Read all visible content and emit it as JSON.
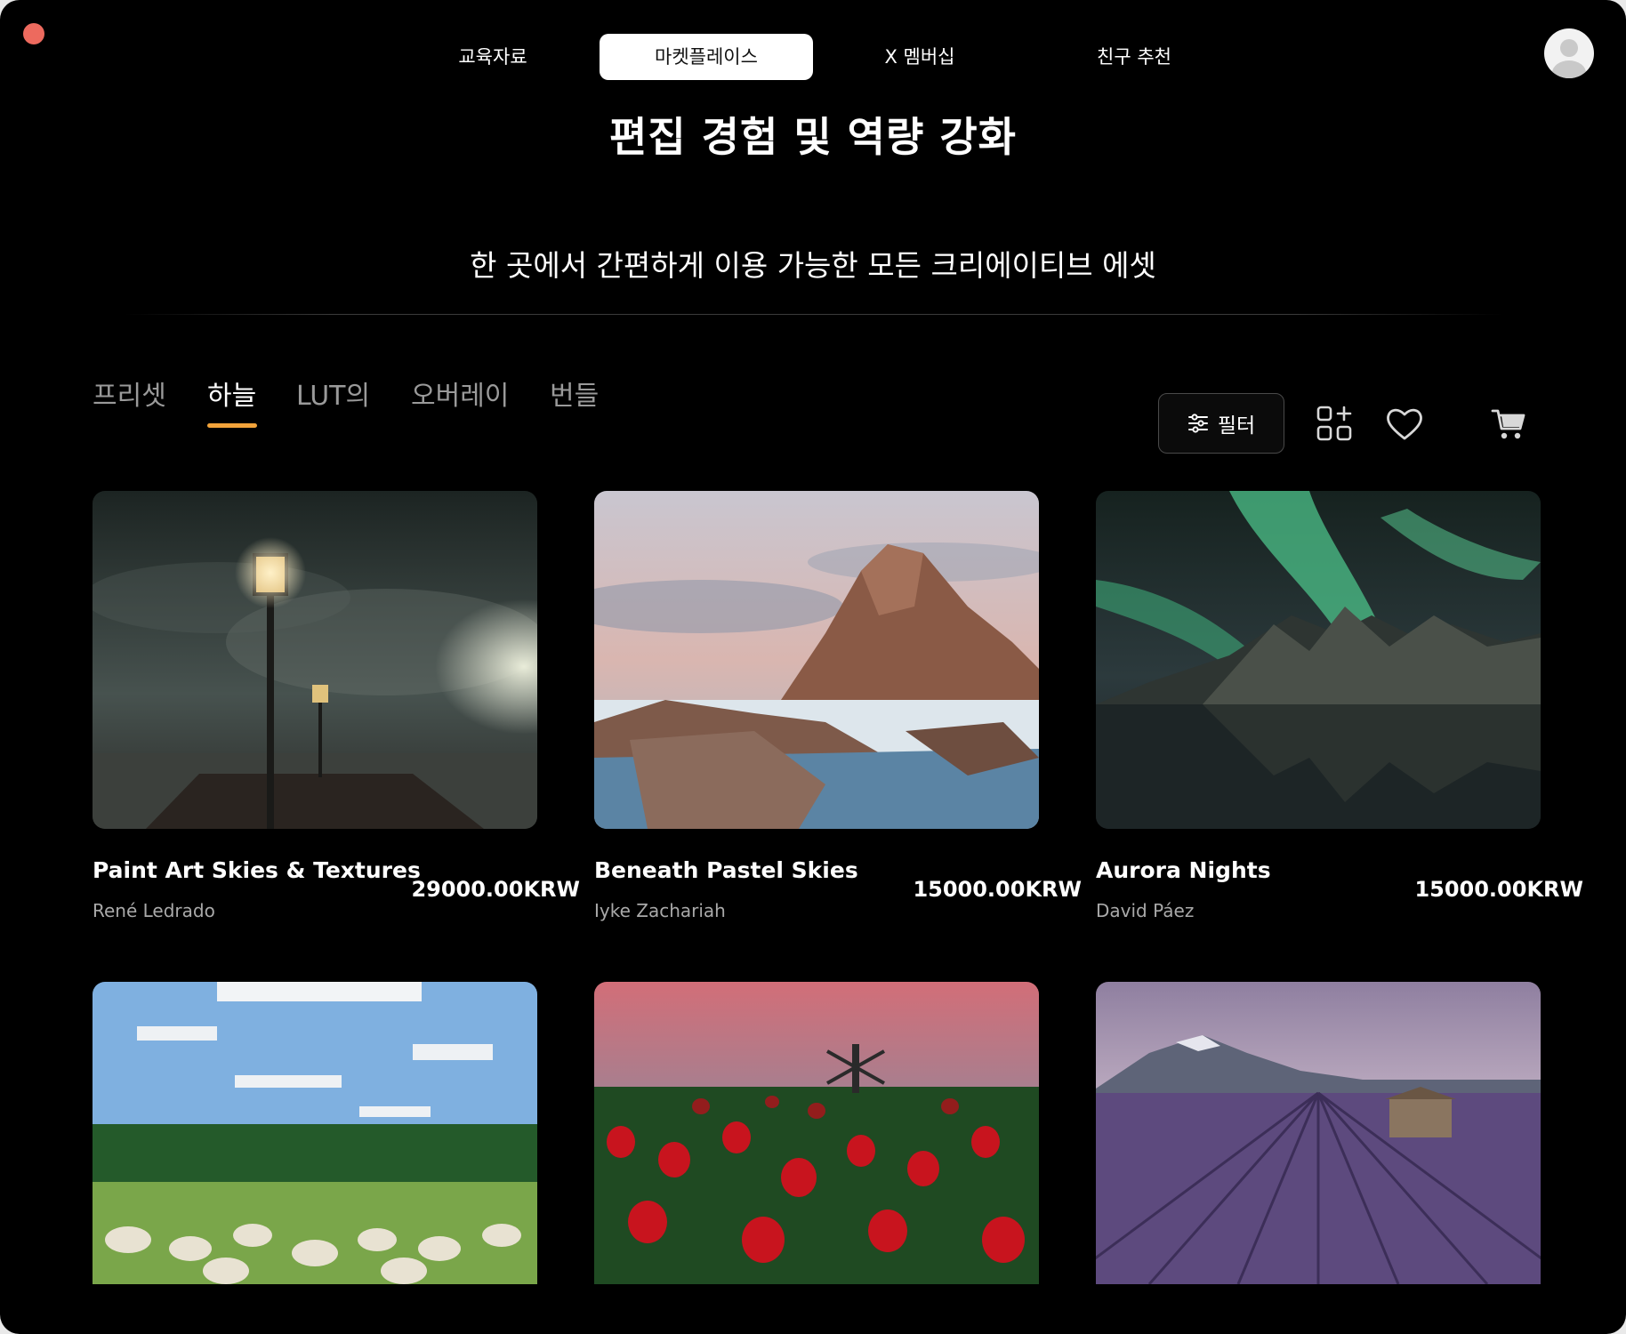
{
  "nav": {
    "items": [
      {
        "label": "교육자료"
      },
      {
        "label": "마켓플레이스"
      },
      {
        "label": "X 멤버십"
      },
      {
        "label": "친구 추천"
      }
    ]
  },
  "hero": {
    "title": "편집 경험 및 역량 강화",
    "subtitle": "한 곳에서 간편하게 이용 가능한 모든 크리에이티브 에셋"
  },
  "tabs": [
    {
      "label": "프리셋"
    },
    {
      "label": "하늘"
    },
    {
      "label": "LUT의"
    },
    {
      "label": "오버레이"
    },
    {
      "label": "번들"
    }
  ],
  "toolbar": {
    "filter_label": "필터"
  },
  "products": [
    {
      "title": "Paint Art Skies & Textures",
      "author": "René Ledrado",
      "price": "29000.00KRW"
    },
    {
      "title": "Beneath Pastel Skies",
      "author": "Iyke Zachariah",
      "price": "15000.00KRW"
    },
    {
      "title": "Aurora Nights",
      "author": "David Páez",
      "price": "15000.00KRW"
    }
  ],
  "colors": {
    "accent": "#f2a33a",
    "close_dot": "#ed6a5e",
    "background": "#000000"
  }
}
